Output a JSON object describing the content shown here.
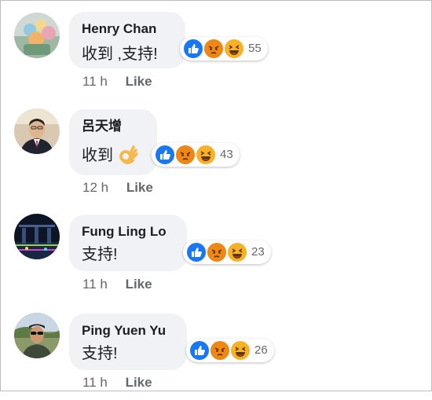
{
  "comments": [
    {
      "author": "Henry Chan",
      "text": "收到 ,支持!",
      "reaction_count": "55",
      "time": "11 h",
      "like_label": "Like"
    },
    {
      "author": "呂天增",
      "text": "收到",
      "reaction_count": "43",
      "time": "12 h",
      "like_label": "Like"
    },
    {
      "author": "Fung Ling Lo",
      "text": "支持!",
      "reaction_count": "23",
      "time": "11 h",
      "like_label": "Like"
    },
    {
      "author": "Ping Yuen Yu",
      "text": "支持!",
      "reaction_count": "26",
      "time": "11 h",
      "like_label": "Like"
    }
  ],
  "reaction_icons": [
    "like-reaction-icon",
    "angry-reaction-icon",
    "haha-reaction-icon"
  ],
  "colors": {
    "like": "#1877f2",
    "angry": "#e9710f",
    "haha": "#f7b125",
    "bubble": "#f0f2f5",
    "meta": "#65676b"
  }
}
